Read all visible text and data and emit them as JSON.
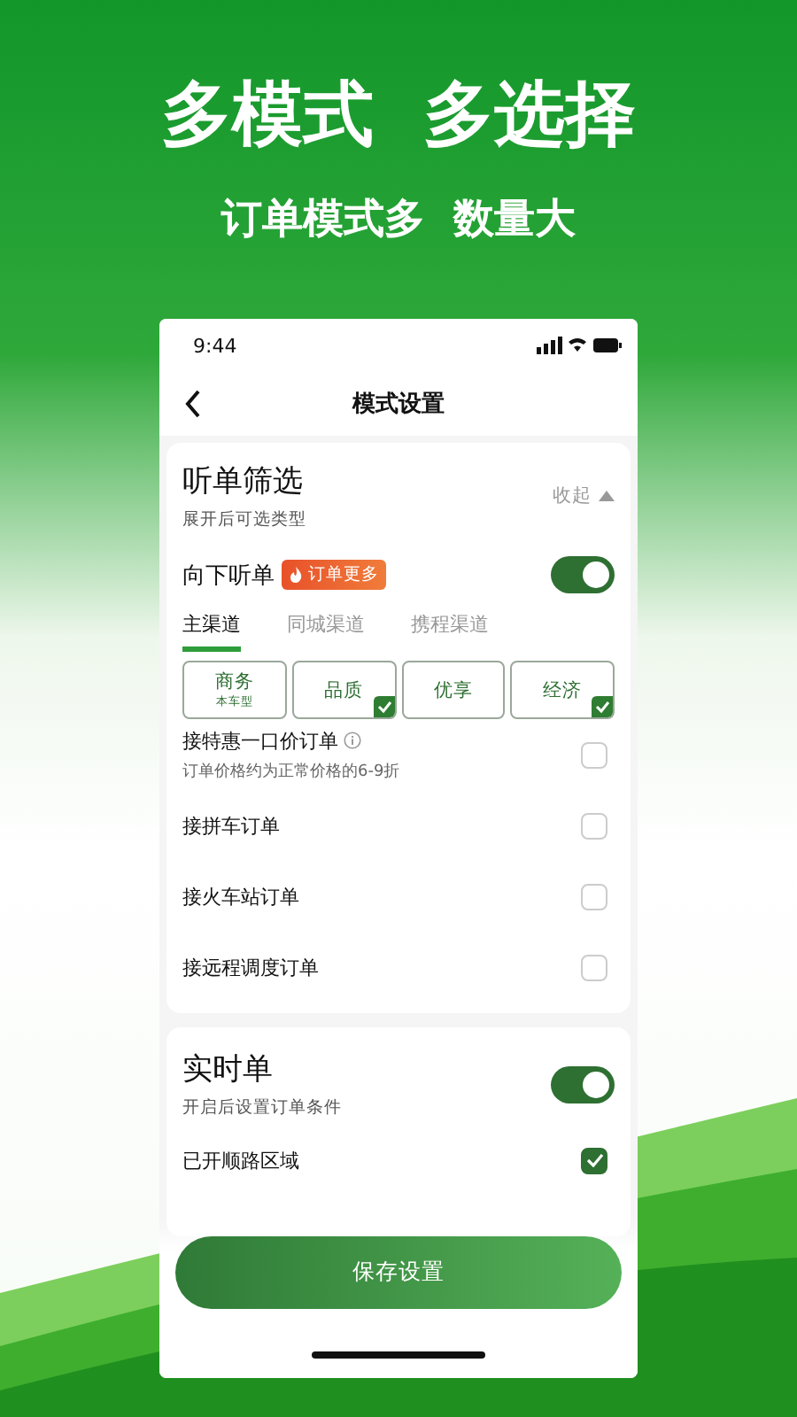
{
  "headline": "多模式  多选择",
  "subheadline": "订单模式多  数量大",
  "status_bar": {
    "time": "9:44"
  },
  "nav": {
    "title": "模式设置"
  },
  "filter_card": {
    "title": "听单筛选",
    "subtitle": "展开后可选类型",
    "collapse_label": "收起",
    "listen_row": {
      "label": "向下听单",
      "badge": "订单更多",
      "on": true
    },
    "channel_tabs": [
      {
        "label": "主渠道",
        "selected": true
      },
      {
        "label": "同城渠道",
        "selected": false
      },
      {
        "label": "携程渠道",
        "selected": false
      }
    ],
    "car_types": [
      {
        "label": "商务",
        "sublabel": "本车型",
        "checked": false
      },
      {
        "label": "品质",
        "checked": true
      },
      {
        "label": "优享",
        "checked": false
      },
      {
        "label": "经济",
        "checked": true
      }
    ],
    "options": [
      {
        "label": "接特惠一口价订单",
        "note": "订单价格约为正常价格的6-9折",
        "kind": "info",
        "checked": false
      },
      {
        "label": "接拼车订单",
        "kind": "plain",
        "checked": false
      },
      {
        "label": "接火车站订单",
        "kind": "plain",
        "checked": false
      },
      {
        "label": "接远程调度订单",
        "kind": "plain",
        "checked": false
      }
    ]
  },
  "realtime_card": {
    "title": "实时单",
    "subtitle": "开启后设置订单条件",
    "on": true,
    "area_row": {
      "label": "已开顺路区域",
      "checked": true
    }
  },
  "save_button": "保存设置"
}
